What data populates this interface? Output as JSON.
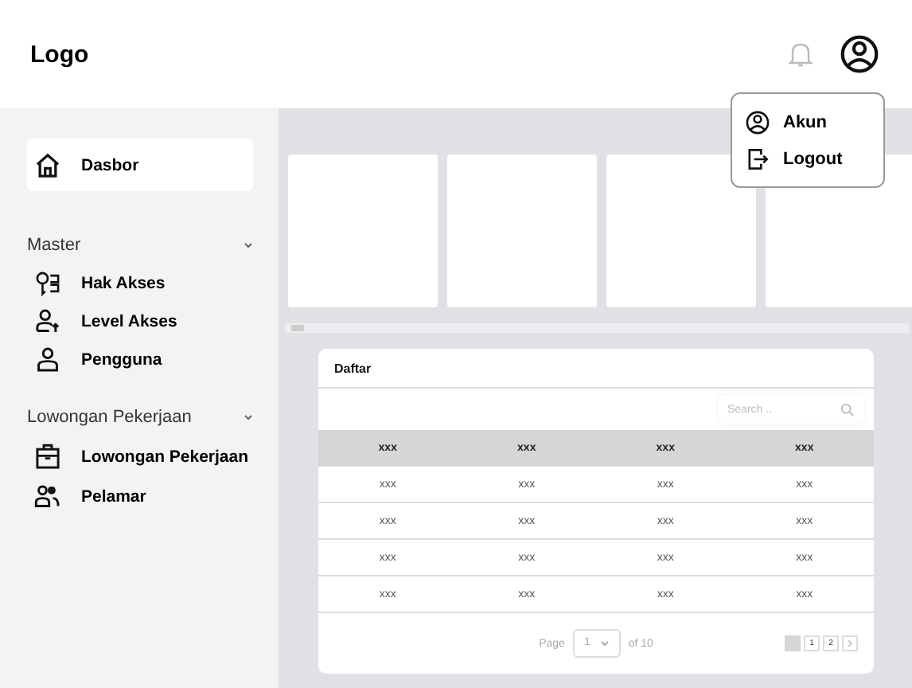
{
  "header": {
    "logo": "Logo"
  },
  "account_menu": {
    "open": true,
    "items": [
      {
        "kind": "account",
        "label": "Akun"
      },
      {
        "kind": "logout",
        "label": "Logout"
      }
    ]
  },
  "sidebar": {
    "items": [
      {
        "kind": "home",
        "label": "Dasbor",
        "selected": true
      }
    ],
    "groups": [
      {
        "title": "Master",
        "expanded": true,
        "items": [
          {
            "kind": "key",
            "label": "Hak Akses",
            "selected": false
          },
          {
            "kind": "user-level",
            "label": "Level Akses",
            "selected": false
          },
          {
            "kind": "user",
            "label": "Pengguna",
            "selected": false
          }
        ]
      },
      {
        "title": "Lowongan Pekerjaan",
        "expanded": true,
        "items": [
          {
            "kind": "briefcase",
            "label": "Lowongan Pekerjaan",
            "selected": false
          },
          {
            "kind": "users",
            "label": "Pelamar",
            "selected": false
          }
        ]
      }
    ]
  },
  "table": {
    "title": "Daftar",
    "search": {
      "placeholder": "Search .."
    },
    "columns": [
      "xxx",
      "xxx",
      "xxx",
      "xxx"
    ],
    "rows": [
      [
        "xxx",
        "xxx",
        "xxx",
        "xxx"
      ],
      [
        "xxx",
        "xxx",
        "xxx",
        "xxx"
      ],
      [
        "xxx",
        "xxx",
        "xxx",
        "xxx"
      ],
      [
        "xxx",
        "xxx",
        "xxx",
        "xxx"
      ]
    ],
    "pagination": {
      "label": "Page",
      "page": "1",
      "total": "of 10",
      "pages": [
        {
          "label": "1",
          "selected": false
        },
        {
          "label": "2",
          "selected": false
        }
      ]
    }
  }
}
